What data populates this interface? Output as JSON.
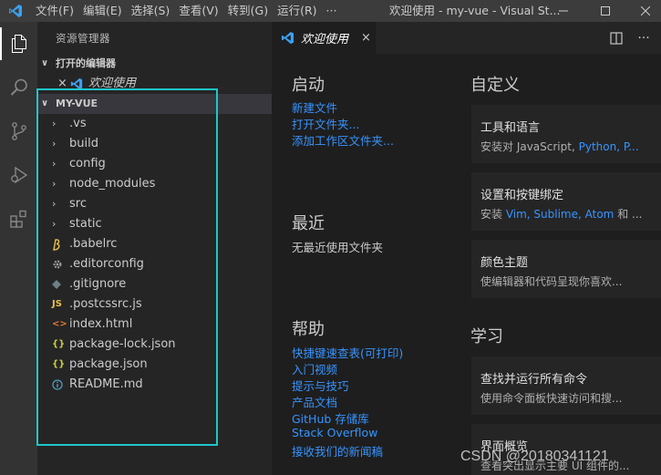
{
  "titlebar": {
    "menus": [
      "文件(F)",
      "编辑(E)",
      "选择(S)",
      "查看(V)",
      "转到(G)",
      "运行(R)",
      "···"
    ],
    "title": "欢迎使用 - my-vue - Visual St..."
  },
  "sidebar": {
    "title": "资源管理器",
    "open_editors_label": "打开的编辑器",
    "open_editor_item": "欢迎使用",
    "project_name": "MY-VUE",
    "items": [
      {
        "label": ".vs",
        "kind": "folder"
      },
      {
        "label": "build",
        "kind": "folder"
      },
      {
        "label": "config",
        "kind": "folder"
      },
      {
        "label": "node_modules",
        "kind": "folder"
      },
      {
        "label": "src",
        "kind": "folder"
      },
      {
        "label": "static",
        "kind": "folder"
      },
      {
        "label": ".babelrc",
        "kind": "babel"
      },
      {
        "label": ".editorconfig",
        "kind": "gear"
      },
      {
        "label": ".gitignore",
        "kind": "git"
      },
      {
        "label": ".postcssrc.js",
        "kind": "js"
      },
      {
        "label": "index.html",
        "kind": "html"
      },
      {
        "label": "package-lock.json",
        "kind": "json"
      },
      {
        "label": "package.json",
        "kind": "json"
      },
      {
        "label": "README.md",
        "kind": "info"
      }
    ],
    "icon_texts": {
      "js": "JS",
      "json": "{}",
      "html": "<>",
      "folder": "›"
    }
  },
  "tab": {
    "label": "欢迎使用",
    "close": "×"
  },
  "welcome": {
    "start": {
      "heading": "启动",
      "links": [
        "新建文件",
        "打开文件夹...",
        "添加工作区文件夹..."
      ]
    },
    "recent": {
      "heading": "最近",
      "empty": "无最近使用文件夹"
    },
    "help": {
      "heading": "帮助",
      "links": [
        "快捷键速查表(可打印)",
        "入门视频",
        "提示与技巧",
        "产品文档",
        "GitHub 存储库",
        "Stack Overflow",
        "接收我们的新闻稿"
      ]
    },
    "customize": {
      "heading": "自定义",
      "cards": [
        {
          "title": "工具和语言",
          "desc_prefix": "安装对 JavaScript, ",
          "desc_links": "Python, P..."
        },
        {
          "title": "设置和按键绑定",
          "desc_prefix": "安装 ",
          "desc_links": "Vim, Sublime, Atom",
          "desc_suffix": " 和 ..."
        },
        {
          "title": "颜色主题",
          "desc_prefix": "使编辑器和代码呈现你喜欢...",
          "desc_links": ""
        }
      ]
    },
    "learn": {
      "heading": "学习",
      "cards": [
        {
          "title": "查找并运行所有命令",
          "desc_prefix": "使用命令面板快速访问和搜...",
          "desc_links": ""
        },
        {
          "title": "界面概览",
          "desc_prefix": "查看突出显示主要 UI 组件的...",
          "desc_links": ""
        }
      ]
    }
  },
  "watermark": "CSDN @20180341121",
  "colors": {
    "accent": "#007acc",
    "link": "#3794ff",
    "highlight_box": "#1fc6c9"
  }
}
